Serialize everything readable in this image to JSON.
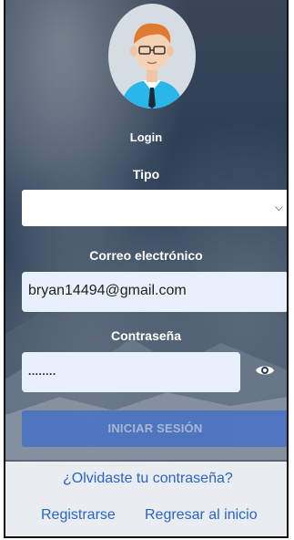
{
  "header": {
    "login_label": "Login"
  },
  "form": {
    "type_label": "Tipo",
    "type_selected": "",
    "email_label": "Correo electrónico",
    "email_value": "bryan14494@gmail.com",
    "password_label": "Contraseña",
    "password_value": "........",
    "submit_label": "INICIAR SESIÓN"
  },
  "footer": {
    "forgot_password": "¿Olvidaste tu contraseña?",
    "register": "Registrarse",
    "back_home": "Regresar al inicio"
  },
  "colors": {
    "accent": "#4a73c2",
    "link": "#2a64c8",
    "input_fill": "#e8f0fe"
  },
  "icons": {
    "avatar": "user-avatar-icon",
    "eye": "eye-icon",
    "chevron": "chevron-down-icon"
  }
}
